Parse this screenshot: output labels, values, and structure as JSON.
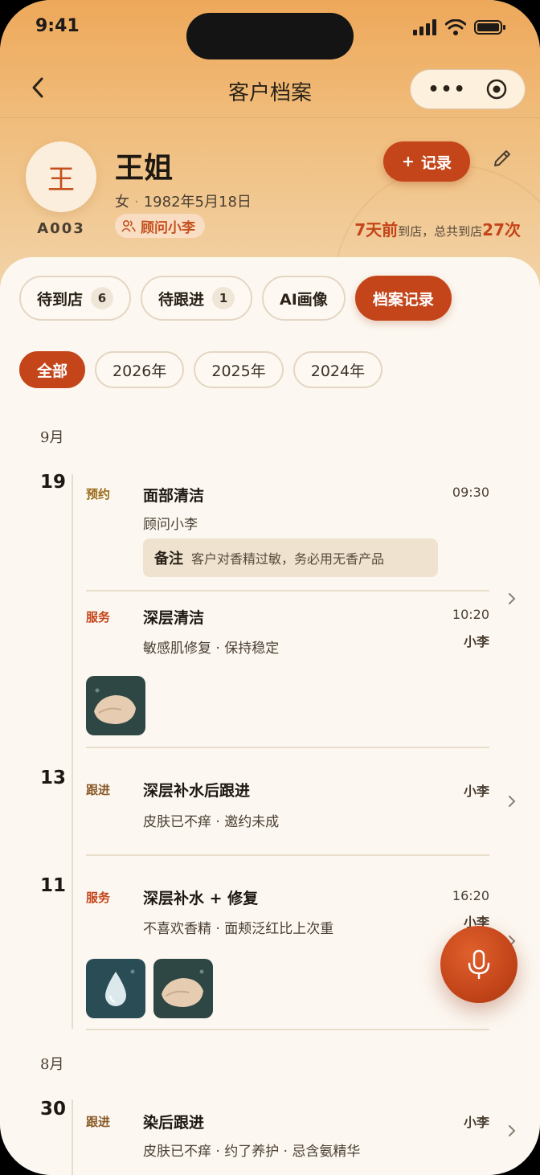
{
  "status_bar": {
    "time": "9:41"
  },
  "nav": {
    "title": "客户档案",
    "capsule_dots": "•••"
  },
  "customer": {
    "avatar_char": "王",
    "id": "A003",
    "name": "王姐",
    "gender": "女",
    "birthday": "1982年5月18日",
    "advisor": "顾问小李",
    "record_button": "记录",
    "record_button_icon": "+",
    "last_visit": "7天前",
    "last_visit_suffix": "到店，总共到店",
    "total_visits": "27次"
  },
  "tabs": [
    {
      "label": "待到店",
      "count": "6",
      "active": false
    },
    {
      "label": "待跟进",
      "count": "1",
      "active": false
    },
    {
      "label": "AI画像",
      "active": false
    },
    {
      "label": "档案记录",
      "active": true
    }
  ],
  "year_filters": [
    {
      "label": "全部",
      "active": true
    },
    {
      "label": "2026年",
      "active": false
    },
    {
      "label": "2025年",
      "active": false
    },
    {
      "label": "2024年",
      "active": false
    }
  ],
  "timeline": {
    "months": [
      "9月",
      "8月"
    ],
    "days": [
      "19",
      "13",
      "11",
      "30"
    ],
    "entries": [
      {
        "type": "预约",
        "title": "面部清洁",
        "sub": "顾问小李",
        "time": "09:30",
        "note_label": "备注",
        "note": "客户对香精过敏，务必用无香产品"
      },
      {
        "type": "服务",
        "title": "深层清洁",
        "sub": "敏感肌修复 · 保持稳定",
        "time": "10:20",
        "staff": "小李",
        "thumbs": [
          "skin-thumb"
        ]
      },
      {
        "type": "跟进",
        "title": "深层补水后跟进",
        "sub": "皮肤已不痒 · 邀约未成",
        "staff": "小李"
      },
      {
        "type": "服务",
        "title": "深层补水 + 修复",
        "sub": "不喜欢香精 · 面颊泛红比上次重",
        "time": "16:20",
        "staff": "小李",
        "thumbs": [
          "water-drop-thumb",
          "skin-thumb"
        ]
      },
      {
        "type": "跟进",
        "title": "染后跟进",
        "sub": "皮肤已不痒 · 约了养护 · 忌含氨精华",
        "staff": "小李"
      }
    ]
  },
  "colors": {
    "accent": "#c4451a",
    "header_top": "#eea85a",
    "sheet_bg": "#fcf8f1"
  }
}
